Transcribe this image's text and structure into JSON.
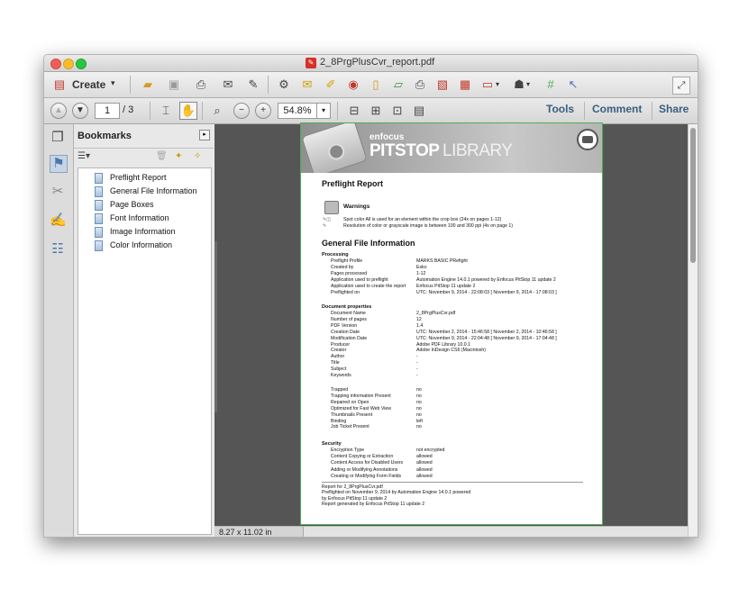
{
  "window": {
    "title": "2_8PrgPlusCvr_report.pdf"
  },
  "toolbar": {
    "create_label": "Create",
    "page_current": "1",
    "page_total": "/ 3",
    "zoom": "54.8%",
    "tools_label": "Tools",
    "comment_label": "Comment",
    "share_label": "Share"
  },
  "bookmarks": {
    "header": "Bookmarks",
    "items": [
      {
        "label": "Preflight Report"
      },
      {
        "label": "General File Information"
      },
      {
        "label": "Page Boxes"
      },
      {
        "label": "Font Information"
      },
      {
        "label": "Image Information"
      },
      {
        "label": "Color Information"
      }
    ]
  },
  "status": {
    "page_size": "8.27 x 11.02 in"
  },
  "document": {
    "brand_small": "enfocus",
    "brand_bold": "PITSTOP",
    "brand_light": "LIBRARY",
    "report_title": "Preflight Report",
    "warnings_title": "Warnings",
    "warnings": [
      "Spot color All is used for an element within the crop box (24x on pages 1-12)",
      "Resolution of color or grayscale image is between 100 and 300 ppi (4x on page 1)"
    ],
    "general_title": "General File Information",
    "processing_title": "Processing",
    "processing": [
      {
        "label": "Preflight Profile",
        "value": "MARKS BASIC PRefight"
      },
      {
        "label": "Created by",
        "value": "Esko"
      },
      {
        "label": "Pages processed",
        "value": "1-12"
      },
      {
        "label": "Application used to preflight",
        "value": "Automation Engine 14.0.1 powered by Enfocus PitStop 11 update 2"
      },
      {
        "label": "Application used to create the report",
        "value": "Enfocus PitStop 11 update 2"
      },
      {
        "label": "Preflighted on",
        "value": "UTC: November 9, 2014 - 22:08:03 [ November 9, 2014 - 17:08:03 ]"
      }
    ],
    "docprops_title": "Document properties",
    "docprops": [
      {
        "label": "Document Name",
        "value": "2_8PrgPlusCvr.pdf"
      },
      {
        "label": "Number of pages",
        "value": "12"
      },
      {
        "label": "PDF Version",
        "value": "1.4"
      },
      {
        "label": "Creation Date",
        "value": "UTC: November 2, 2014 - 15:46:58 [ November 2, 2014 - 10:46:58 ]"
      },
      {
        "label": "Modification Date",
        "value": "UTC: November 9, 2014 - 22:04:48 [ November 9, 2014 - 17:04:48 ]"
      },
      {
        "label": "Producer",
        "value": "Adobe PDF Library 10.0.1"
      },
      {
        "label": "Creator",
        "value": "Adobe InDesign CS6 (Macintosh)"
      },
      {
        "label": "Author",
        "value": "-"
      },
      {
        "label": "Title",
        "value": "-"
      },
      {
        "label": "Subject",
        "value": "-"
      },
      {
        "label": "Keywords",
        "value": "-"
      }
    ],
    "docprops2": [
      {
        "label": "Trapped",
        "value": "no"
      },
      {
        "label": "Trapping information Present",
        "value": "no"
      },
      {
        "label": "Repaired on Open",
        "value": "no"
      },
      {
        "label": "Optimized for Fast Web View",
        "value": "no"
      },
      {
        "label": "Thumbnails Present",
        "value": "no"
      },
      {
        "label": "Binding",
        "value": "left"
      },
      {
        "label": "Job Ticket Present",
        "value": "no"
      }
    ],
    "security_title": "Security",
    "security": [
      {
        "label": "Encryption Type",
        "value": "not encrypted"
      },
      {
        "label": "Content Copying or Extraction",
        "value": "allowed"
      },
      {
        "label": "Content Access for Disabled Users",
        "value": "allowed"
      },
      {
        "label": "Adding or Modifying Annotations",
        "value": "allowed"
      },
      {
        "label": "Creating or Modifying Form Fields",
        "value": "allowed"
      }
    ],
    "footer": [
      "Report for 2_8PrgPlusCvr.pdf",
      "Preflighted on November 9, 2014 by Automation Engine 14.0.1 powered",
      "by Enfocus PitStop 11 update 2",
      "Report generated by Enfocus PitStop 11 update 2"
    ]
  }
}
